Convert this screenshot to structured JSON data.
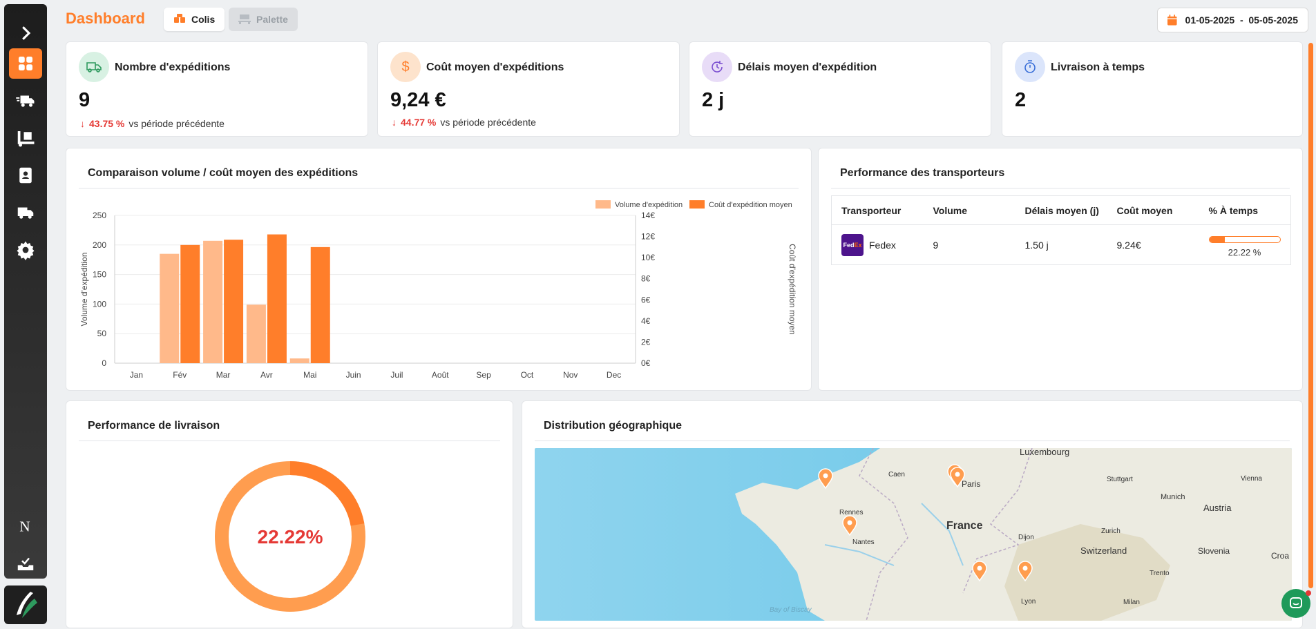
{
  "header": {
    "title": "Dashboard",
    "tab_colis": "Colis",
    "tab_palette": "Palette",
    "date_range": "01-05-2025  -  05-05-2025"
  },
  "sidebar": {
    "items": [
      "expand",
      "dashboard",
      "shipments",
      "pallets",
      "contacts",
      "carriers",
      "settings",
      "notion",
      "inbox"
    ],
    "active": "dashboard"
  },
  "kpis": [
    {
      "title": "Nombre d'expéditions",
      "value": "9",
      "trend_pct": "43.75 %",
      "trend_text": "vs période précédente",
      "icon": "truck-icon",
      "color": "#d8f1e3"
    },
    {
      "title": "Coût moyen d'expéditions",
      "value": "9,24 €",
      "trend_pct": "44.77 %",
      "trend_text": "vs période précédente",
      "icon": "dollar-icon",
      "color": "#fde3cc"
    },
    {
      "title": "Délais moyen d'expédition",
      "value": "2 j",
      "icon": "clock-refresh-icon",
      "color": "#e8dcf7"
    },
    {
      "title": "Livraison à temps",
      "value": "2",
      "icon": "stopwatch-icon",
      "color": "#dbe5fb"
    }
  ],
  "volume_chart": {
    "section_title": "Comparaison volume / coût moyen des expéditions"
  },
  "chart_data": {
    "type": "bar",
    "categories": [
      "Jan",
      "Fév",
      "Mar",
      "Avr",
      "Mai",
      "Juin",
      "Juil",
      "Août",
      "Sep",
      "Oct",
      "Nov",
      "Dec"
    ],
    "series": [
      {
        "name": "Volume d'expédition",
        "axis": "left",
        "color": "#ffb98a",
        "values": [
          0,
          185,
          207,
          99,
          8,
          0,
          0,
          0,
          0,
          0,
          0,
          0
        ]
      },
      {
        "name": "Coût d'expédition moyen",
        "axis": "right",
        "color": "#ff7e2a",
        "values": [
          0,
          11.2,
          11.7,
          12.2,
          11.0,
          0,
          0,
          0,
          0,
          0,
          0,
          0
        ]
      }
    ],
    "ylabel": "Volume d'expédition",
    "y2label": "Coût d'expédition moyen",
    "ylim": [
      0,
      250
    ],
    "y2lim": [
      0,
      14
    ],
    "yticks": [
      "250",
      "200",
      "150",
      "100",
      "50",
      "0"
    ],
    "y2ticks": [
      "14€",
      "12€",
      "10€",
      "8€",
      "6€",
      "4€",
      "2€",
      "0€"
    ],
    "legend_position": "top-right",
    "grid": true
  },
  "carriers": {
    "section_title": "Performance des transporteurs",
    "columns": [
      "Transporteur",
      "Volume",
      "Délais moyen (j)",
      "Coût moyen",
      "% À temps"
    ],
    "rows": [
      {
        "name": "Fedex",
        "volume": "9",
        "delay": "1.50 j",
        "cost": "9.24€",
        "on_time": "22.22 %",
        "on_time_value": 22.22
      }
    ]
  },
  "delivery": {
    "section_title": "Performance de livraison",
    "percent_text": "22.22%",
    "percent_value": 22.22
  },
  "geo": {
    "section_title": "Distribution géographique",
    "labels": [
      "Luxembourg",
      "Caen",
      "Paris",
      "Stuttgart",
      "Vienna",
      "Rennes",
      "France",
      "Munich",
      "Austria",
      "Zurich",
      "Dijon",
      "Switzerland",
      "Slovenia",
      "Croa",
      "Nantes",
      "Trento",
      "Milan",
      "Lyon",
      "Bay of Biscay"
    ]
  }
}
